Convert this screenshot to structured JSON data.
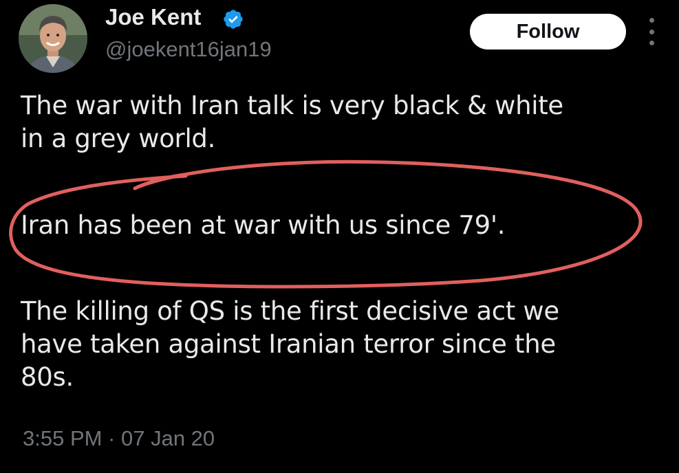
{
  "author": {
    "name": "Joe Kent",
    "handle": "@joekent16jan19",
    "verified": true
  },
  "actions": {
    "follow_label": "Follow",
    "more_icon": "more-vertical-icon"
  },
  "tweet": {
    "paragraphs": [
      [
        "The war with Iran talk is very black & white",
        "in a grey world."
      ],
      [
        "Iran has been at war with us since 79'."
      ],
      [
        "The killing of QS is the first decisive act we",
        "have taken against Iranian terror since the",
        "80s."
      ]
    ],
    "timestamp": "3:55 PM · 07 Jan 20"
  },
  "colors": {
    "background": "#000000",
    "text": "#e7e9ea",
    "secondary_text": "#71767b",
    "verified_badge": "#1d9bf0",
    "annotation_circle": "#e0605e",
    "follow_button_bg": "#ffffff"
  }
}
